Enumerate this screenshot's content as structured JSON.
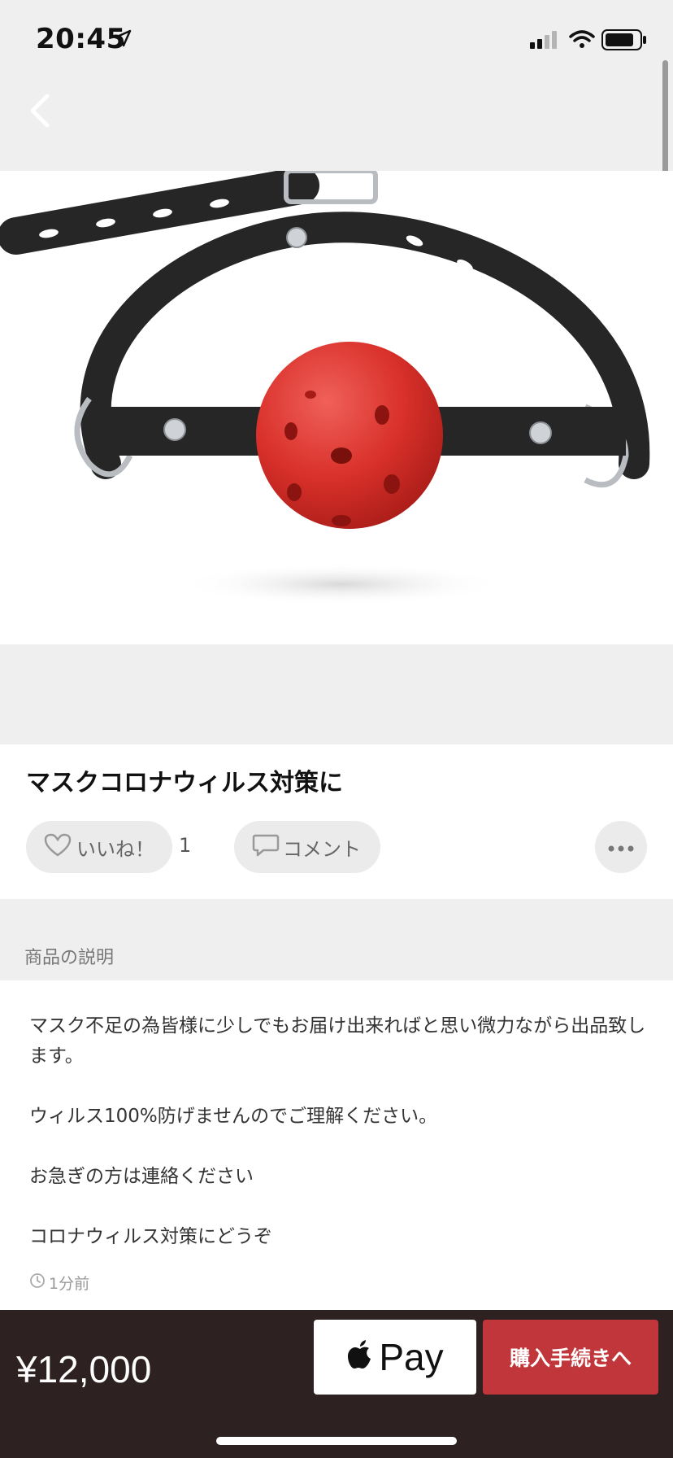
{
  "status_bar": {
    "time": "20:45",
    "icons": [
      "location-arrow-icon",
      "signal-icon",
      "wifi-icon",
      "battery-icon"
    ]
  },
  "nav": {
    "back_icon": "chevron-left-icon"
  },
  "product": {
    "image": "product-photo",
    "title": "マスクコロナウィルス対策に"
  },
  "actions": {
    "like_label": "いいね！",
    "like_count": "1",
    "comment_label": "コメント",
    "more_icon": "more-dots-icon"
  },
  "description_section": {
    "header": "商品の説明",
    "text": "マスク不足の為皆様に少しでもお届け出来ればと思い微力ながら出品致します。\n\nウィルス100%防げませんのでご理解ください。\n\nお急ぎの方は連絡ください\n\nコロナウィルス対策にどうぞ",
    "timestamp": "1分前"
  },
  "footer": {
    "price": "¥12,000",
    "apple_pay_label": "Pay",
    "purchase_label": "購入手続きへ"
  },
  "colors": {
    "background_gray": "#efefef",
    "footer_bg": "#2d2221",
    "purchase_button": "#c0363a",
    "chip_bg": "#ebebeb"
  }
}
